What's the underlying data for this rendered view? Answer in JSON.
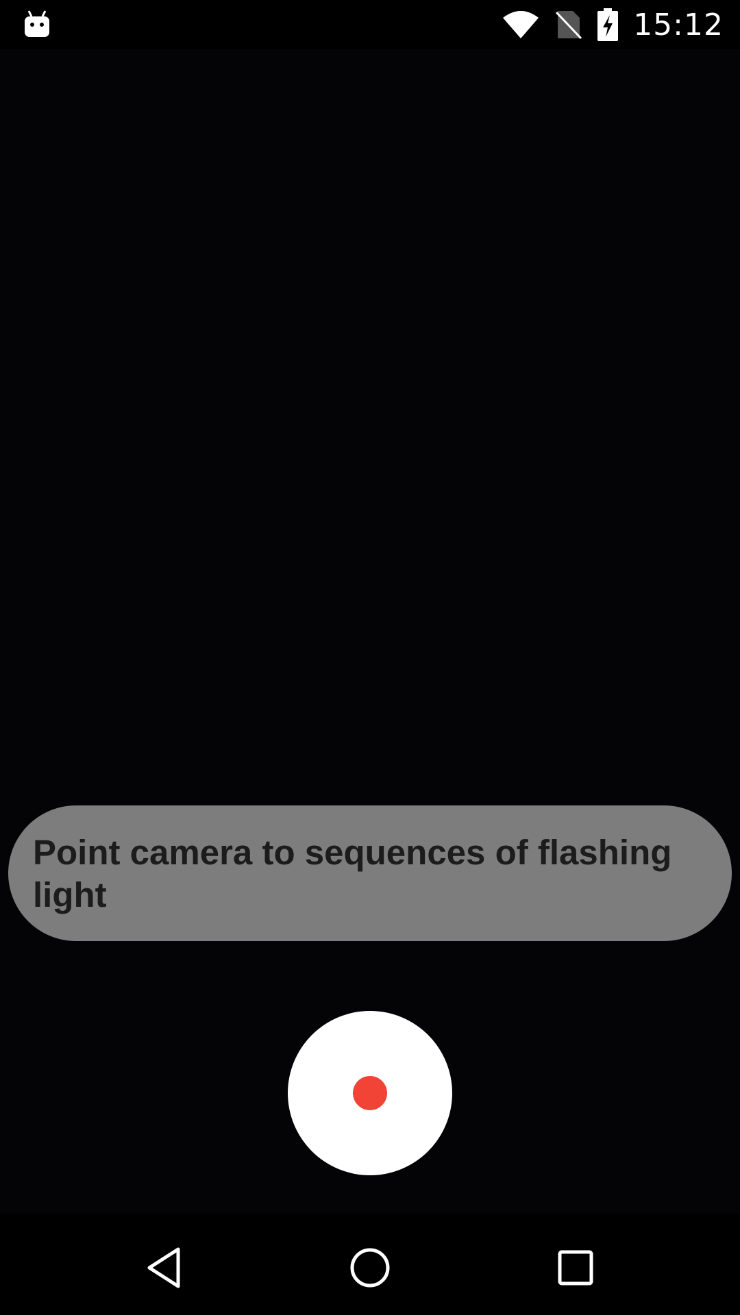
{
  "status_bar": {
    "time": "15:12",
    "icons": [
      "android-notification-icon",
      "wifi-icon",
      "no-sim-icon",
      "battery-charging-icon"
    ]
  },
  "hint": {
    "text": "Point camera to sequences of flashing light"
  },
  "shutter": {
    "icon": "record-icon",
    "dot_color": "#f24436"
  },
  "nav_bar": {
    "icons": [
      "back-icon",
      "home-icon",
      "recents-icon"
    ]
  }
}
